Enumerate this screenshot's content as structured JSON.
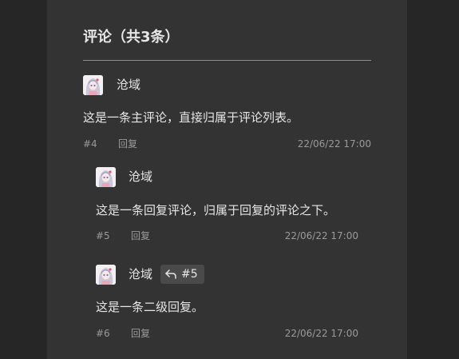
{
  "comments_section": {
    "title": "评论（共3条）"
  },
  "comments": [
    {
      "author": "沧域",
      "text": "这是一条主评论，直接归属于评论列表。",
      "id_label": "#4",
      "reply_label": "回复",
      "timestamp": "22/06/22 17:00"
    },
    {
      "author": "沧域",
      "text": "这是一条回复评论，归属于回复的评论之下。",
      "id_label": "#5",
      "reply_label": "回复",
      "timestamp": "22/06/22 17:00"
    },
    {
      "author": "沧域",
      "reply_to": "#5",
      "text": "这是一条二级回复。",
      "id_label": "#6",
      "reply_label": "回复",
      "timestamp": "22/06/22 17:00"
    }
  ],
  "icons": {
    "reply_to": "reply-arrow-icon",
    "avatar": "anime-girl-avatar"
  },
  "colors": {
    "page_background": "#262626",
    "panel_background": "#333333",
    "text_primary": "#e6e6e6",
    "text_meta": "#9a9a9a",
    "badge_background": "#4a4a4a"
  }
}
